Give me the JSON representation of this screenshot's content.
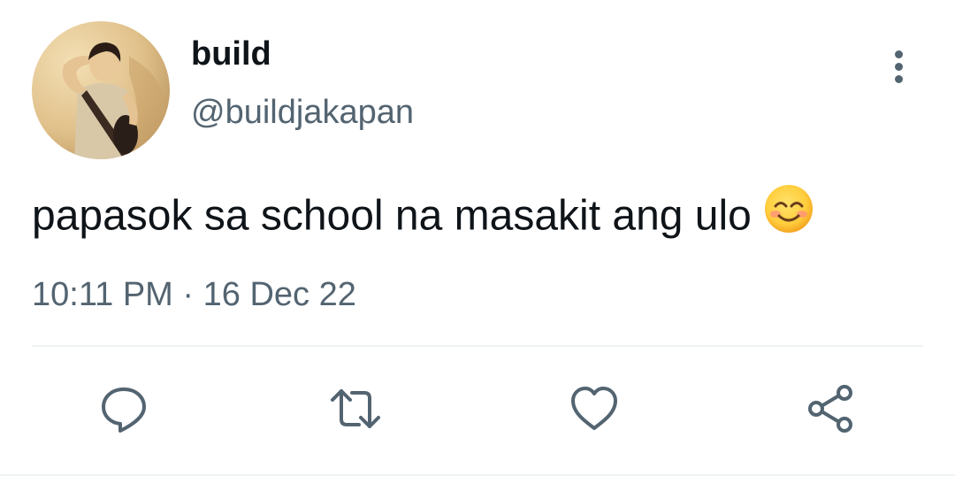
{
  "author": {
    "display_name": "build",
    "handle": "@buildjakapan"
  },
  "tweet": {
    "text": "papasok sa school na masakit ang ulo",
    "emoji": "smiling-face-with-smiling-eyes",
    "time": "10:11 PM",
    "separator": "·",
    "date": "16 Dec 22"
  },
  "actions": [
    {
      "icon": "reply-icon"
    },
    {
      "icon": "retweet-icon"
    },
    {
      "icon": "like-icon"
    },
    {
      "icon": "share-icon"
    }
  ],
  "colors": {
    "text_primary": "#0f1419",
    "text_secondary": "#536471",
    "icon": "#536471",
    "divider": "#eff3f4"
  }
}
